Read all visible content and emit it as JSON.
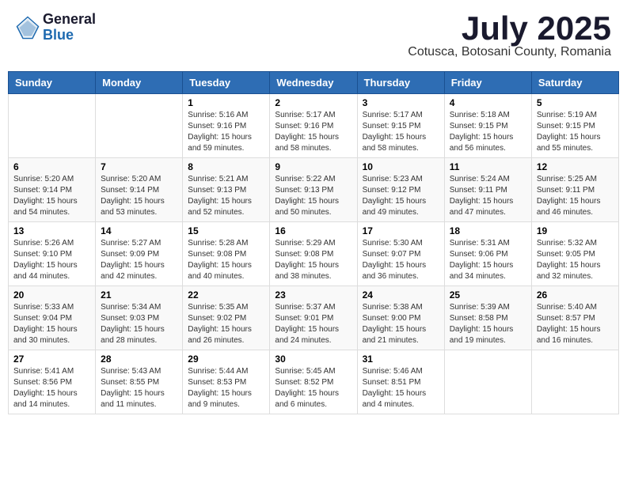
{
  "logo": {
    "general": "General",
    "blue": "Blue"
  },
  "header": {
    "month_year": "July 2025",
    "location": "Cotusca, Botosani County, Romania"
  },
  "weekdays": [
    "Sunday",
    "Monday",
    "Tuesday",
    "Wednesday",
    "Thursday",
    "Friday",
    "Saturday"
  ],
  "weeks": [
    [
      {
        "day": "",
        "info": ""
      },
      {
        "day": "",
        "info": ""
      },
      {
        "day": "1",
        "info": "Sunrise: 5:16 AM\nSunset: 9:16 PM\nDaylight: 15 hours and 59 minutes."
      },
      {
        "day": "2",
        "info": "Sunrise: 5:17 AM\nSunset: 9:16 PM\nDaylight: 15 hours and 58 minutes."
      },
      {
        "day": "3",
        "info": "Sunrise: 5:17 AM\nSunset: 9:15 PM\nDaylight: 15 hours and 58 minutes."
      },
      {
        "day": "4",
        "info": "Sunrise: 5:18 AM\nSunset: 9:15 PM\nDaylight: 15 hours and 56 minutes."
      },
      {
        "day": "5",
        "info": "Sunrise: 5:19 AM\nSunset: 9:15 PM\nDaylight: 15 hours and 55 minutes."
      }
    ],
    [
      {
        "day": "6",
        "info": "Sunrise: 5:20 AM\nSunset: 9:14 PM\nDaylight: 15 hours and 54 minutes."
      },
      {
        "day": "7",
        "info": "Sunrise: 5:20 AM\nSunset: 9:14 PM\nDaylight: 15 hours and 53 minutes."
      },
      {
        "day": "8",
        "info": "Sunrise: 5:21 AM\nSunset: 9:13 PM\nDaylight: 15 hours and 52 minutes."
      },
      {
        "day": "9",
        "info": "Sunrise: 5:22 AM\nSunset: 9:13 PM\nDaylight: 15 hours and 50 minutes."
      },
      {
        "day": "10",
        "info": "Sunrise: 5:23 AM\nSunset: 9:12 PM\nDaylight: 15 hours and 49 minutes."
      },
      {
        "day": "11",
        "info": "Sunrise: 5:24 AM\nSunset: 9:11 PM\nDaylight: 15 hours and 47 minutes."
      },
      {
        "day": "12",
        "info": "Sunrise: 5:25 AM\nSunset: 9:11 PM\nDaylight: 15 hours and 46 minutes."
      }
    ],
    [
      {
        "day": "13",
        "info": "Sunrise: 5:26 AM\nSunset: 9:10 PM\nDaylight: 15 hours and 44 minutes."
      },
      {
        "day": "14",
        "info": "Sunrise: 5:27 AM\nSunset: 9:09 PM\nDaylight: 15 hours and 42 minutes."
      },
      {
        "day": "15",
        "info": "Sunrise: 5:28 AM\nSunset: 9:08 PM\nDaylight: 15 hours and 40 minutes."
      },
      {
        "day": "16",
        "info": "Sunrise: 5:29 AM\nSunset: 9:08 PM\nDaylight: 15 hours and 38 minutes."
      },
      {
        "day": "17",
        "info": "Sunrise: 5:30 AM\nSunset: 9:07 PM\nDaylight: 15 hours and 36 minutes."
      },
      {
        "day": "18",
        "info": "Sunrise: 5:31 AM\nSunset: 9:06 PM\nDaylight: 15 hours and 34 minutes."
      },
      {
        "day": "19",
        "info": "Sunrise: 5:32 AM\nSunset: 9:05 PM\nDaylight: 15 hours and 32 minutes."
      }
    ],
    [
      {
        "day": "20",
        "info": "Sunrise: 5:33 AM\nSunset: 9:04 PM\nDaylight: 15 hours and 30 minutes."
      },
      {
        "day": "21",
        "info": "Sunrise: 5:34 AM\nSunset: 9:03 PM\nDaylight: 15 hours and 28 minutes."
      },
      {
        "day": "22",
        "info": "Sunrise: 5:35 AM\nSunset: 9:02 PM\nDaylight: 15 hours and 26 minutes."
      },
      {
        "day": "23",
        "info": "Sunrise: 5:37 AM\nSunset: 9:01 PM\nDaylight: 15 hours and 24 minutes."
      },
      {
        "day": "24",
        "info": "Sunrise: 5:38 AM\nSunset: 9:00 PM\nDaylight: 15 hours and 21 minutes."
      },
      {
        "day": "25",
        "info": "Sunrise: 5:39 AM\nSunset: 8:58 PM\nDaylight: 15 hours and 19 minutes."
      },
      {
        "day": "26",
        "info": "Sunrise: 5:40 AM\nSunset: 8:57 PM\nDaylight: 15 hours and 16 minutes."
      }
    ],
    [
      {
        "day": "27",
        "info": "Sunrise: 5:41 AM\nSunset: 8:56 PM\nDaylight: 15 hours and 14 minutes."
      },
      {
        "day": "28",
        "info": "Sunrise: 5:43 AM\nSunset: 8:55 PM\nDaylight: 15 hours and 11 minutes."
      },
      {
        "day": "29",
        "info": "Sunrise: 5:44 AM\nSunset: 8:53 PM\nDaylight: 15 hours and 9 minutes."
      },
      {
        "day": "30",
        "info": "Sunrise: 5:45 AM\nSunset: 8:52 PM\nDaylight: 15 hours and 6 minutes."
      },
      {
        "day": "31",
        "info": "Sunrise: 5:46 AM\nSunset: 8:51 PM\nDaylight: 15 hours and 4 minutes."
      },
      {
        "day": "",
        "info": ""
      },
      {
        "day": "",
        "info": ""
      }
    ]
  ]
}
